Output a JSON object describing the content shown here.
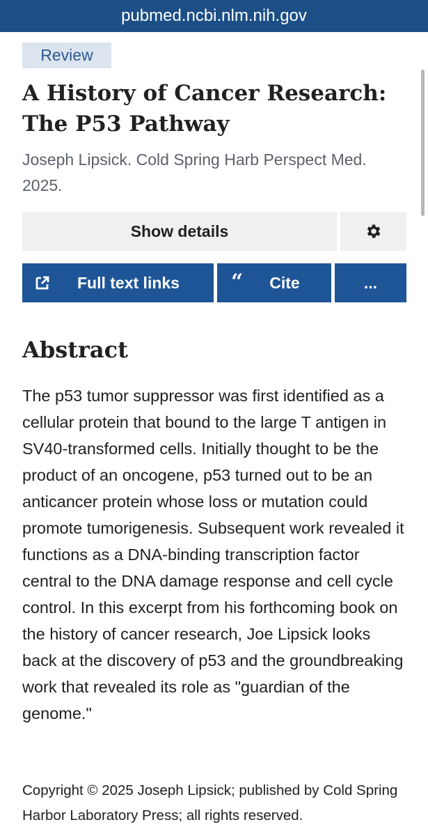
{
  "browser": {
    "url": "pubmed.ncbi.nlm.nih.gov"
  },
  "article": {
    "type_badge": "Review",
    "title": "A History of Cancer Research: The P53 Pathway",
    "citation": "Joseph Lipsick. Cold Spring Harb Perspect Med. 2025."
  },
  "actions": {
    "show_details": "Show details",
    "settings_icon": "gear-icon",
    "full_text_links": "Full text links",
    "full_text_icon": "external-link-icon",
    "cite": "Cite",
    "cite_icon": "quote-icon",
    "more": "..."
  },
  "abstract": {
    "heading": "Abstract",
    "text": "The p53 tumor suppressor was first identified as a cellular protein that bound to the large T antigen in SV40-transformed cells. Initially thought to be the product of an oncogene, p53 turned out to be an anticancer protein whose loss or mutation could promote tumorigenesis. Subsequent work revealed it functions as a DNA-binding transcription factor central to the DNA damage response and cell cycle control. In this excerpt from his forthcoming book on the history of cancer research, Joe Lipsick looks back at the discovery of p53 and the groundbreaking work that revealed its role as \"guardian of the genome.\"",
    "copyright": "Copyright © 2025 Joseph Lipsick; published by Cold Spring Harbor Laboratory Press; all rights reserved."
  },
  "colors": {
    "top_bar": "#1d4f87",
    "primary_button": "#1d5596",
    "badge_background": "#dce4ef",
    "light_button": "#f0f0f0"
  }
}
